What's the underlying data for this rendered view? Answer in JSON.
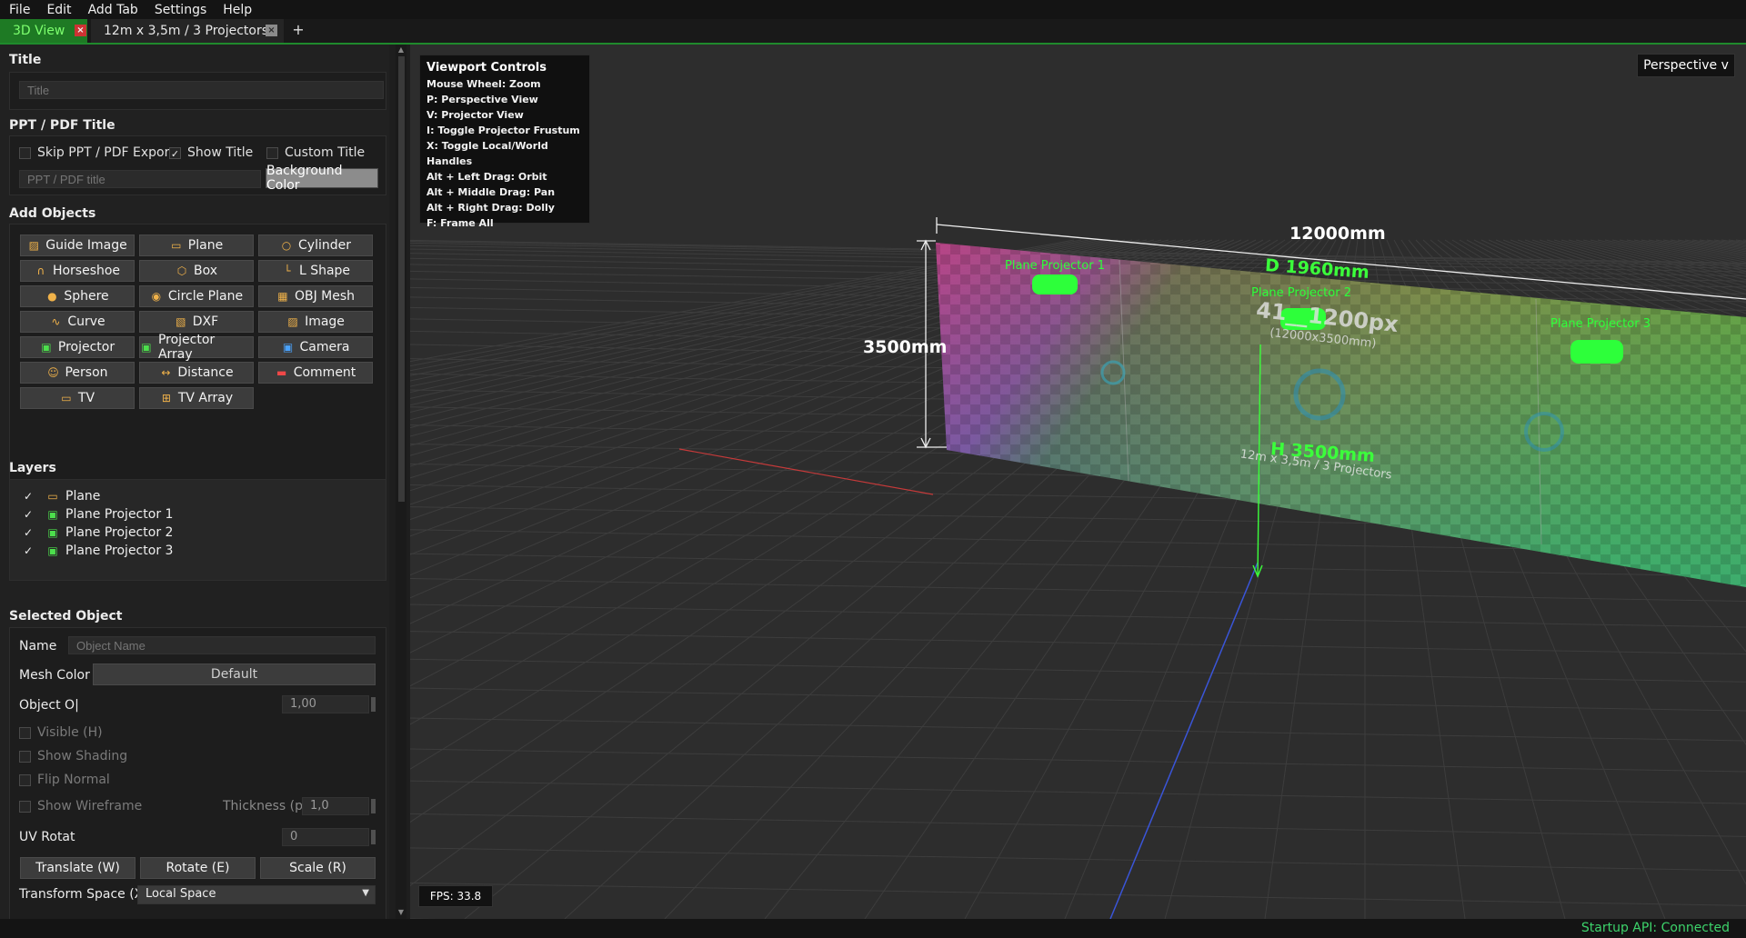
{
  "menu": [
    "File",
    "Edit",
    "Add Tab",
    "Settings",
    "Help"
  ],
  "tabs": [
    {
      "label": "3D View",
      "close": "×"
    },
    {
      "label": "12m x 3,5m / 3 Projectors",
      "close": "×"
    }
  ],
  "tab_add": "+",
  "title_section": {
    "heading": "Title",
    "placeholder": "Title"
  },
  "pdf_section": {
    "heading": "PPT / PDF Title",
    "skip_export": "Skip PPT / PDF Export",
    "show_title": "Show Title",
    "show_title_checked": "✓",
    "custom_title": "Custom Title",
    "placeholder": "PPT / PDF title",
    "bg_color_button": "Background Color"
  },
  "add_objects": {
    "heading": "Add Objects",
    "buttons": [
      {
        "label": "Guide Image",
        "icon": "image-icon"
      },
      {
        "label": "Plane",
        "icon": "plane-icon"
      },
      {
        "label": "Cylinder",
        "icon": "cylinder-icon"
      },
      {
        "label": "Horseshoe",
        "icon": "horseshoe-icon"
      },
      {
        "label": "Box",
        "icon": "box-icon"
      },
      {
        "label": "L Shape",
        "icon": "l-shape-icon"
      },
      {
        "label": "Sphere",
        "icon": "sphere-icon"
      },
      {
        "label": "Circle Plane",
        "icon": "circle-plane-icon"
      },
      {
        "label": "OBJ Mesh",
        "icon": "mesh-icon"
      },
      {
        "label": "Curve",
        "icon": "curve-icon"
      },
      {
        "label": "DXF",
        "icon": "dxf-icon"
      },
      {
        "label": "Image",
        "icon": "image-icon"
      },
      {
        "label": "Projector",
        "icon": "projector-icon"
      },
      {
        "label": "Projector Array",
        "icon": "projector-array-icon"
      },
      {
        "label": "Camera",
        "icon": "camera-icon"
      },
      {
        "label": "Person",
        "icon": "person-icon"
      },
      {
        "label": "Distance",
        "icon": "distance-icon"
      },
      {
        "label": "Comment",
        "icon": "comment-icon"
      },
      {
        "label": "TV",
        "icon": "tv-icon"
      },
      {
        "label": "TV Array",
        "icon": "tv-array-icon"
      }
    ]
  },
  "layers": {
    "heading": "Layers",
    "check": "✓",
    "items": [
      {
        "label": "Plane",
        "icon": "plane-icon"
      },
      {
        "label": "Plane Projector 1",
        "icon": "projector-icon"
      },
      {
        "label": "Plane Projector 2",
        "icon": "projector-icon"
      },
      {
        "label": "Plane Projector 3",
        "icon": "projector-icon"
      }
    ]
  },
  "selected": {
    "heading": "Selected Object",
    "name_label": "Name",
    "name_placeholder": "Object Name",
    "mesh_color_label": "Mesh Color",
    "mesh_color_value": "Default",
    "opacity_label": "Object O|",
    "opacity_value": "1,00",
    "visible": "Visible (H)",
    "show_shading": "Show Shading",
    "flip_normal": "Flip Normal",
    "show_wireframe": "Show Wireframe",
    "thickness_label": "Thickness (px)",
    "thickness_value": "1,0",
    "uv_label": "UV Rotat",
    "uv_value": "0",
    "translate": "Translate (W)",
    "rotate": "Rotate (E)",
    "scale": "Scale (R)",
    "transform_label": "Transform Space (X)",
    "transform_value": "Local Space"
  },
  "viewport": {
    "controls_title": "Viewport Controls",
    "controls": [
      "Mouse Wheel: Zoom",
      "P: Perspective View",
      "V: Projector View",
      "I: Toggle Projector Frustum",
      "X: Toggle Local/World Handles",
      "Alt + Left Drag: Orbit",
      "Alt + Middle Drag: Pan",
      "Alt + Right Drag: Dolly",
      "F: Frame All"
    ],
    "view_mode": "Perspective v",
    "fps": "FPS: 33.8",
    "dim_width": "12000mm",
    "dim_height": "3500mm",
    "depth": "D 1960mm",
    "height_label": "H 3500mm",
    "resolution": "41__1200px",
    "resolution_sub": "(12000x3500mm)",
    "plane_name": "12m x 3,5m / 3 Projectors",
    "projectors": [
      "Plane Projector 1",
      "Plane Projector 2",
      "Plane Projector 3"
    ]
  },
  "status": "Startup API: Connected",
  "colors": {
    "accent": "#1f8a2c",
    "status": "#3dd36b",
    "projector": "#2dff3a"
  }
}
